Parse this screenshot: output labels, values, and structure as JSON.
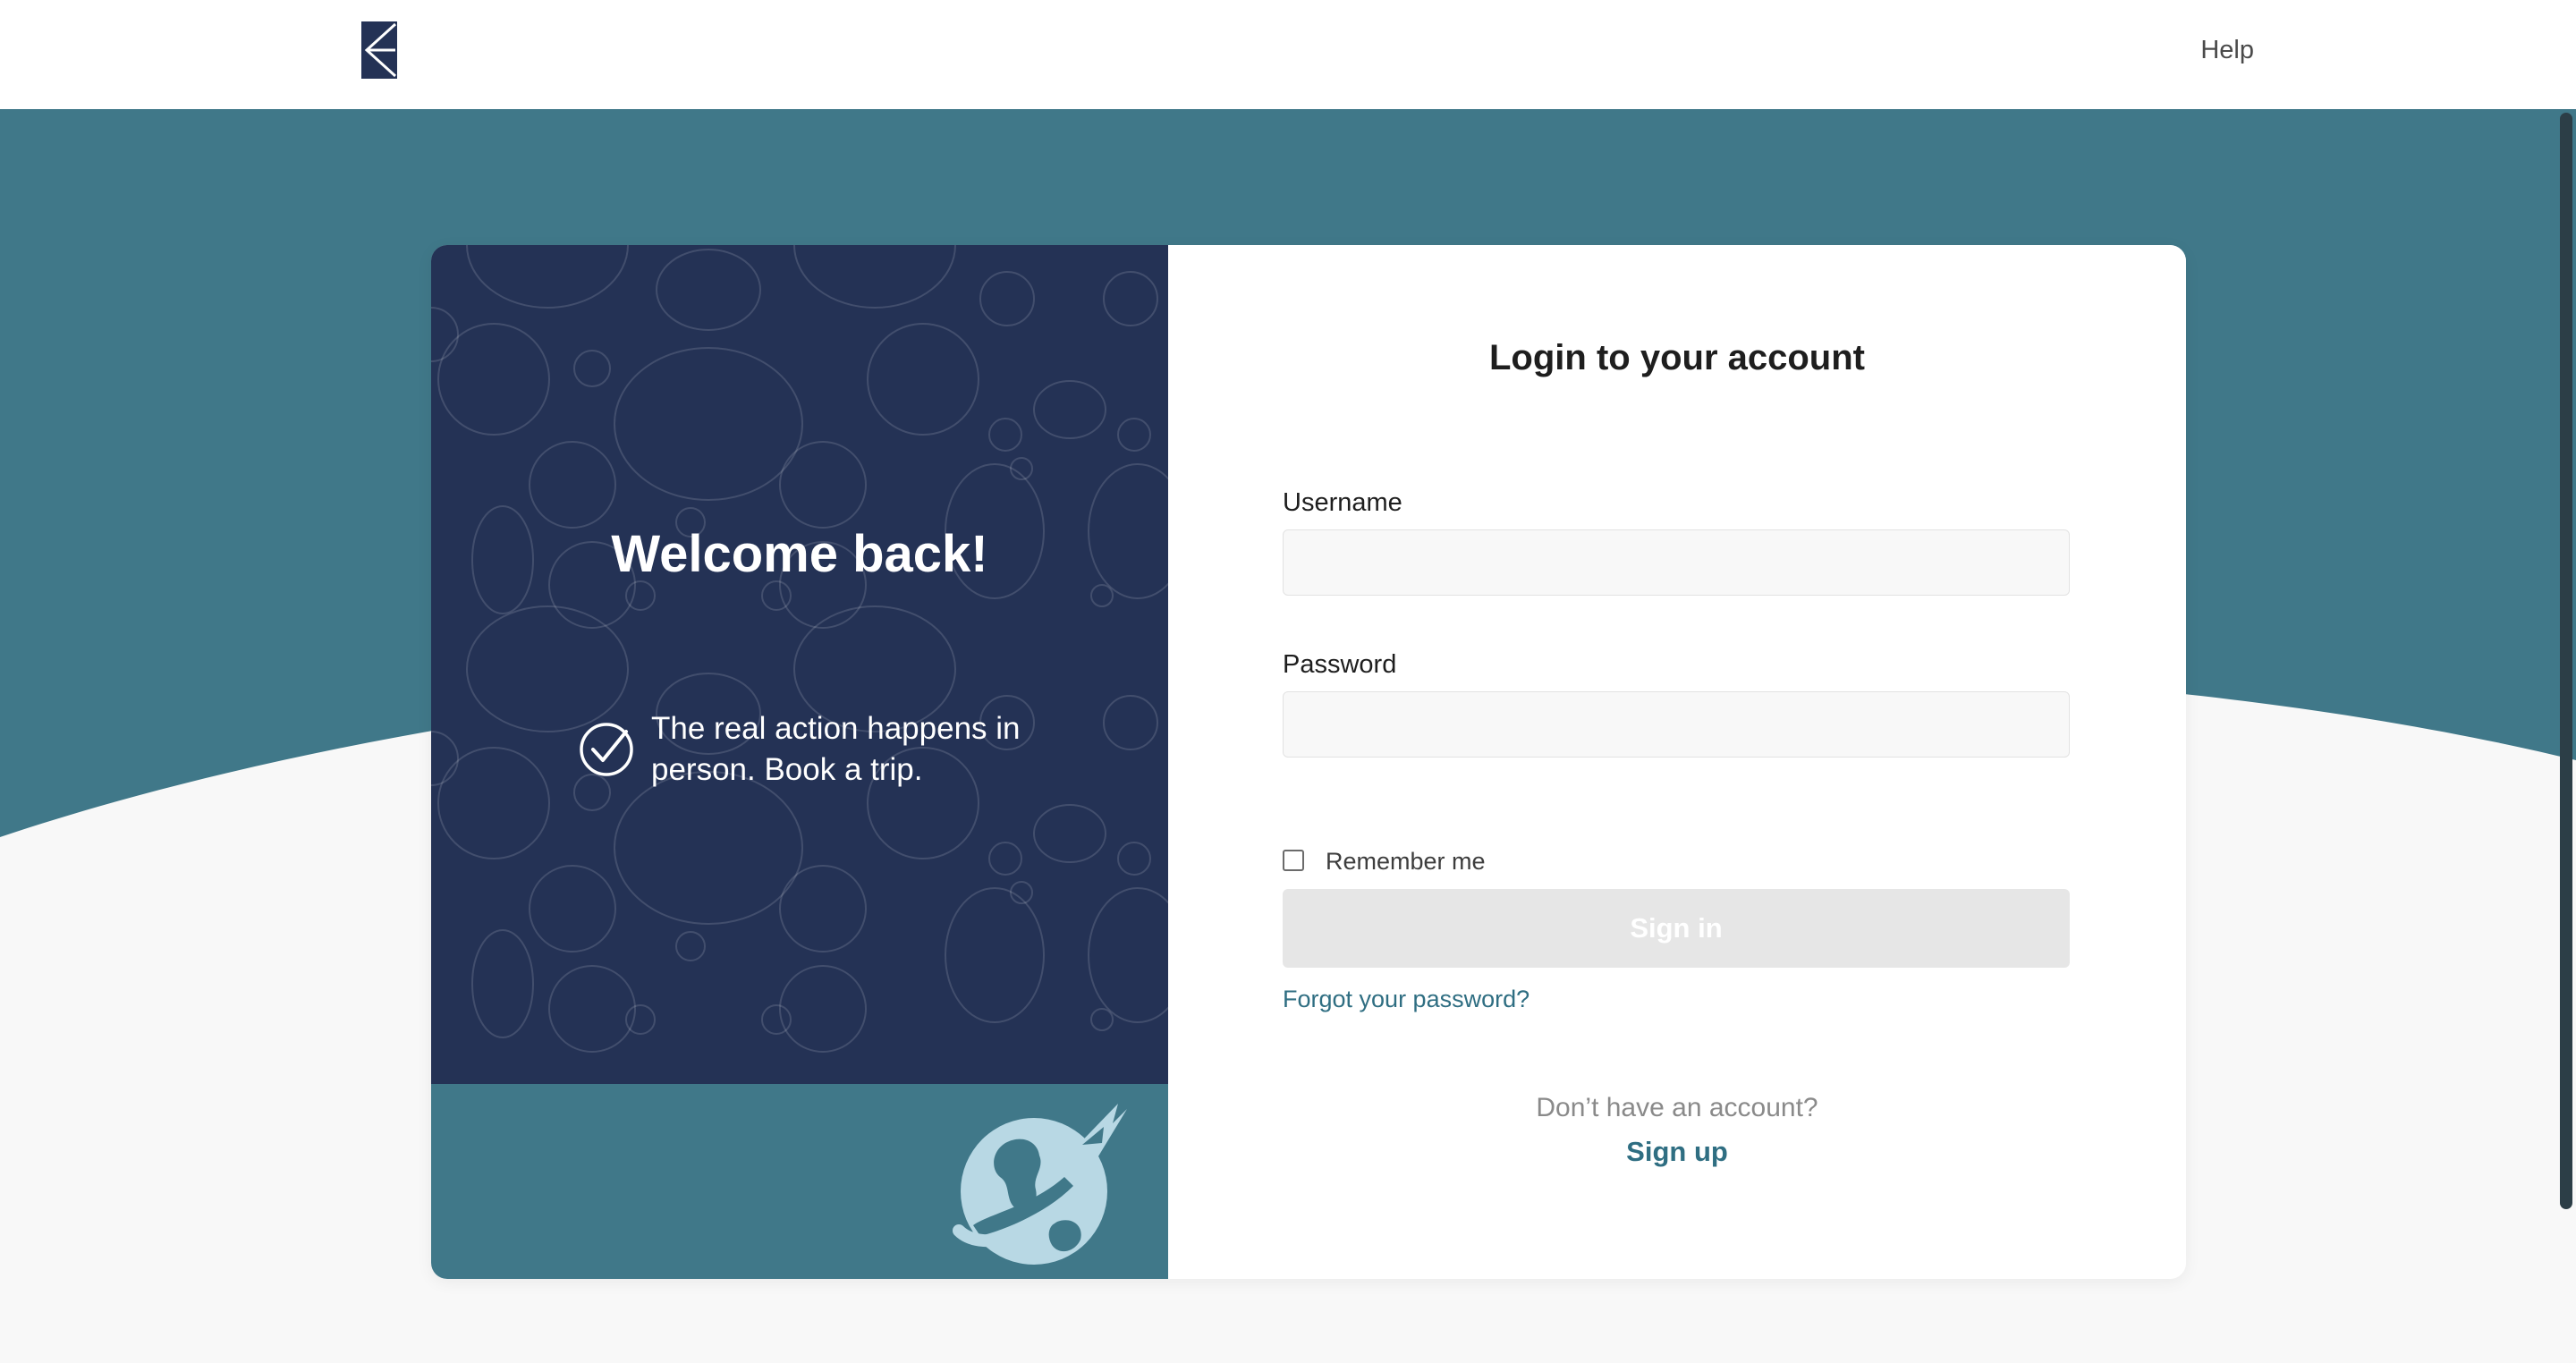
{
  "header": {
    "logo_icon": "brand-logo-icon",
    "help_label": "Help"
  },
  "colors": {
    "navy": "#243255",
    "teal": "#407889",
    "link": "#2f6e82",
    "light_blue": "#b8d8e4"
  },
  "promo": {
    "welcome": "Welcome back!",
    "tagline": "The real action happens in person. Book a trip.",
    "check_icon": "checkmark-circle-icon",
    "illustration_icon": "globe-airplane-icon"
  },
  "login": {
    "title": "Login to your account",
    "username_label": "Username",
    "username_value": "",
    "password_label": "Password",
    "password_value": "",
    "remember_label": "Remember me",
    "remember_checked": false,
    "signin_label": "Sign in",
    "forgot_label": "Forgot your password?",
    "no_account_text": "Don’t have an account?",
    "signup_label": "Sign up"
  }
}
